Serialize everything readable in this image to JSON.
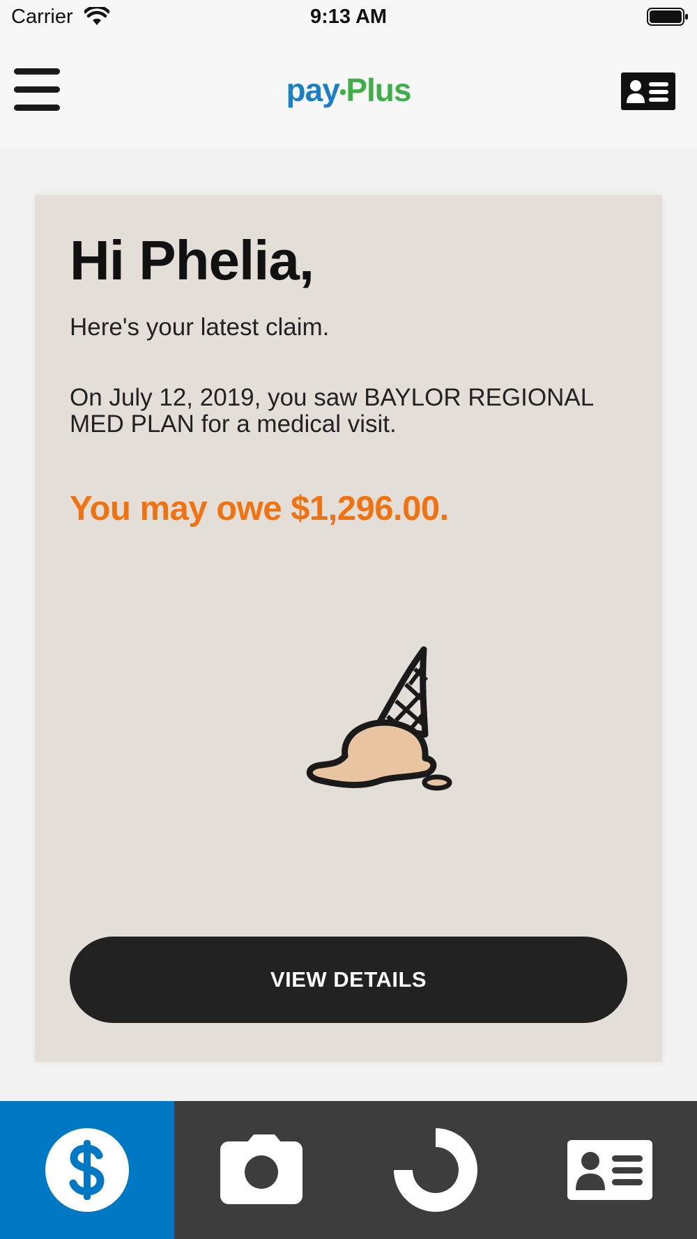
{
  "status_bar": {
    "carrier": "Carrier",
    "time": "9:13 AM"
  },
  "header": {
    "logo_part1": "pay",
    "logo_separator": "•",
    "logo_part2": "Plus",
    "menu_icon": "hamburger-menu-icon",
    "card_icon": "id-card-icon"
  },
  "claim": {
    "greeting": "Hi Phelia,",
    "subtitle": "Here's your latest claim.",
    "visit_text": "On July 12, 2019, you saw BAYLOR REGIONAL MED PLAN for a medical visit.",
    "owe_text": "You may owe $1,296.00.",
    "illustration": "dropped-ice-cream-cone",
    "button_label": "VIEW DETAILS"
  },
  "tabs": [
    {
      "icon": "dollar-icon",
      "active": true
    },
    {
      "icon": "camera-icon",
      "active": false
    },
    {
      "icon": "progress-ring-icon",
      "active": false
    },
    {
      "icon": "id-card-icon",
      "active": false
    }
  ],
  "colors": {
    "brand_blue": "#1b7fc6",
    "brand_green": "#3fae49",
    "owe_orange": "#f07312",
    "card_background": "#e3ded8",
    "button_dark": "#222222",
    "tab_active": "#0078c4",
    "tab_bar": "#3d3d3d"
  }
}
